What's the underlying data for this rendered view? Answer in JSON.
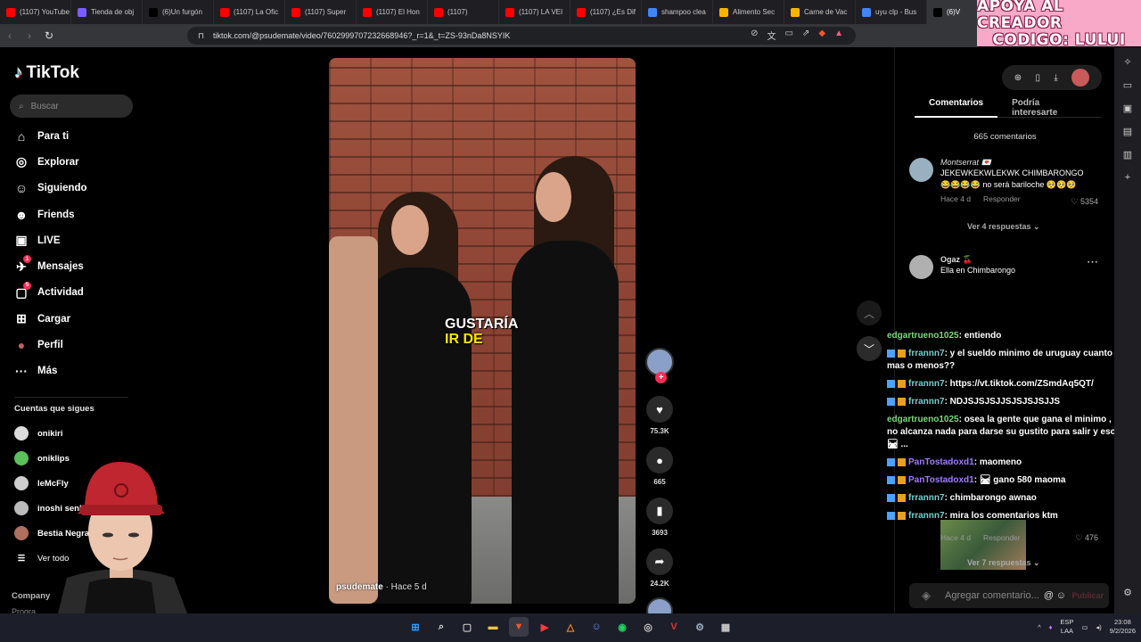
{
  "browser": {
    "tabs": [
      {
        "label": "(1107) YouTube",
        "icon_color": "#ff0000"
      },
      {
        "label": "Tienda de obj",
        "icon_color": "#7b5cff"
      },
      {
        "label": "(6)Un furgón",
        "icon_color": "#000000"
      },
      {
        "label": "(1107) La Ofic",
        "icon_color": "#ff0000"
      },
      {
        "label": "(1107) Super",
        "icon_color": "#ff0000"
      },
      {
        "label": "(1107) El Hon",
        "icon_color": "#ff0000"
      },
      {
        "label": "(1107)",
        "icon_color": "#ff0000"
      },
      {
        "label": "(1107) LA VEI",
        "icon_color": "#ff0000"
      },
      {
        "label": "(1107) ¿Es Dif",
        "icon_color": "#ff0000"
      },
      {
        "label": "shampoo clea",
        "icon_color": "#4285f4"
      },
      {
        "label": "Alimento Sec",
        "icon_color": "#f7b500"
      },
      {
        "label": "Carne de Vac",
        "icon_color": "#f7b500"
      },
      {
        "label": "uyu clp - Bus",
        "icon_color": "#4285f4"
      },
      {
        "label": "(6)V",
        "icon_color": "#000000"
      }
    ],
    "url": "tiktok.com/@psudemate/video/7602999707232668946?_r=1&_t=ZS-93nDa8NSYIK",
    "banner_line1": "APOYA AL CREADOR",
    "banner_line2": "CODIGO: LULUI"
  },
  "tiktok": {
    "logo": "TikTok",
    "search_placeholder": "Buscar",
    "nav": [
      {
        "label": "Para ti",
        "icon": "home-icon",
        "glyph": "⌂"
      },
      {
        "label": "Explorar",
        "icon": "compass-icon",
        "glyph": "◎"
      },
      {
        "label": "Siguiendo",
        "icon": "following-icon",
        "glyph": "☺"
      },
      {
        "label": "Friends",
        "icon": "friends-icon",
        "glyph": "☻"
      },
      {
        "label": "LIVE",
        "icon": "live-icon",
        "glyph": "▣"
      },
      {
        "label": "Mensajes",
        "icon": "messages-icon",
        "glyph": "✈",
        "badge": "1"
      },
      {
        "label": "Actividad",
        "icon": "activity-icon",
        "glyph": "▢",
        "badge": "5"
      },
      {
        "label": "Cargar",
        "icon": "upload-icon",
        "glyph": "⊞"
      },
      {
        "label": "Perfil",
        "icon": "profile-icon",
        "glyph": "●"
      },
      {
        "label": "Más",
        "icon": "more-icon",
        "glyph": "···"
      }
    ],
    "follows_title": "Cuentas que sigues",
    "follows": [
      {
        "name": "onikiri",
        "color": "#dddddd"
      },
      {
        "name": "oniklips",
        "color": "#5cc05c"
      },
      {
        "name": "leMcFly",
        "color": "#cfcfcf"
      },
      {
        "name": "inoshi senhi",
        "color": "#bbbbbb"
      },
      {
        "name": "Bestia Negra HD",
        "color": "#b07060"
      }
    ],
    "see_all": "Ver todo",
    "company": "Company",
    "company2": "Progra"
  },
  "video": {
    "caption_line1": "GUSTARÍA",
    "caption_line2": "IR DE",
    "author": "psudemate",
    "time": "· Hace 5 d",
    "likes": "75.3K",
    "comments": "665",
    "saves": "3693",
    "shares": "24.2K"
  },
  "panel": {
    "tab_comments": "Comentarios",
    "tab_related": "Podría interesarte",
    "comment_count": "665 comentarios",
    "comments": [
      {
        "name": "Montserrat 💌",
        "text": "JEKEWKEKWLEKWK CHIMBARONGO",
        "text2": "😂😂😂😂 no será bariloche 🥺🥺🥺",
        "time": "Hace 4 d",
        "reply": "Responder",
        "likes": "♡ 5354",
        "more": "Ver 4 respuestas ⌄"
      },
      {
        "name": "Ogaz 🍒",
        "text": "Ella en Chimbarongo",
        "time": "Hace 4 d",
        "reply": "Responder",
        "likes": "♡ 476",
        "more": "Ver 7 respuestas ⌄"
      }
    ],
    "add_placeholder": "Agregar comentario...",
    "publish": "Publicar"
  },
  "chat": [
    {
      "user": "edgartrueno1025",
      "msg": ": entiendo",
      "cls": "u1",
      "icons": false
    },
    {
      "user": "frrannn7",
      "msg": ": y el sueldo minimo de uruguay cuanto es mas o menos??",
      "cls": "u2",
      "icons": true
    },
    {
      "user": "frrannn7",
      "msg": ": https://vt.tiktok.com/ZSmdAq5QT/",
      "cls": "u2",
      "icons": true
    },
    {
      "user": "frrannn7",
      "msg": ": NDJSJSJSJJSJSJSJSJJS",
      "cls": "u2",
      "icons": true
    },
    {
      "user": "edgartrueno1025",
      "msg": ": osea la gente que gana el minimo , igual no alcanza nada para darse su gustito para salir y eso creo 🛤 ...",
      "cls": "u1",
      "icons": false
    },
    {
      "user": "PanTostadoxd1",
      "msg": ": maomeno",
      "cls": "u3",
      "icons": true
    },
    {
      "user": "PanTostadoxd1",
      "msg": ": 🛤 gano 580 maoma",
      "cls": "u3",
      "icons": true
    },
    {
      "user": "frrannn7",
      "msg": ": chimbarongo awnao",
      "cls": "u2",
      "icons": true
    },
    {
      "user": "frrannn7",
      "msg": ": mira los comentarios ktm",
      "cls": "u2",
      "icons": true
    }
  ],
  "taskbar": {
    "lang1": "ESP",
    "lang2": "LAA",
    "time": "23:08",
    "date": "9/2/2026"
  }
}
